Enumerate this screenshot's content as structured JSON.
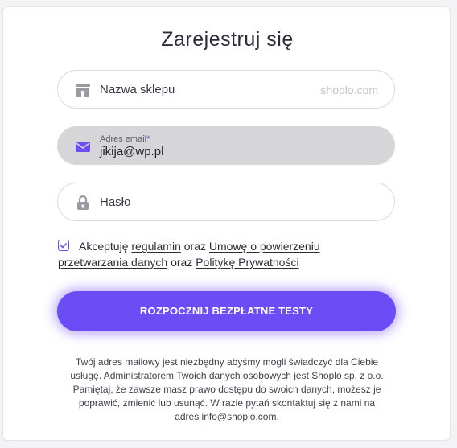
{
  "form": {
    "title": "Zarejestruj się",
    "shop_field": {
      "placeholder": "Nazwa sklepu",
      "suffix": "shoplo.com",
      "icon": "store-icon"
    },
    "email_field": {
      "label": "Adres email",
      "required_mark": "*",
      "value": "jikija@wp.pl",
      "icon": "envelope-icon"
    },
    "password_field": {
      "placeholder": "Hasło",
      "icon": "lock-icon"
    },
    "consent": {
      "checked": true,
      "text_accept": "Akceptuję",
      "link_terms": "regulamin",
      "text_and1": "oraz",
      "link_agreement": "Umowę o powierzeniu",
      "link_agreement_cont": "przetwarzania danych",
      "text_and2": "oraz",
      "link_privacy": "Politykę Prywatności"
    },
    "submit_label": "ROZPOCZNIJ BEZPŁATNE TESTY",
    "note_lines": [
      "Twój adres mailowy jest niezbędny abyśmy mogli świadczyć dla Ciebie",
      "usługę. Administratorem Twoich danych osobowych jest Shoplo sp. z o.o.",
      "Pamiętaj, że zawsze masz prawo dostępu do swoich danych, możesz je",
      "poprawić, zmienić lub usunąć. W razie pytań skontaktuj się z nami na",
      "adres info@shoplo.com."
    ]
  },
  "colors": {
    "accent": "#6c4cf5",
    "email_bg": "#d6d6d9",
    "icon_gray": "#9a9aa3"
  }
}
